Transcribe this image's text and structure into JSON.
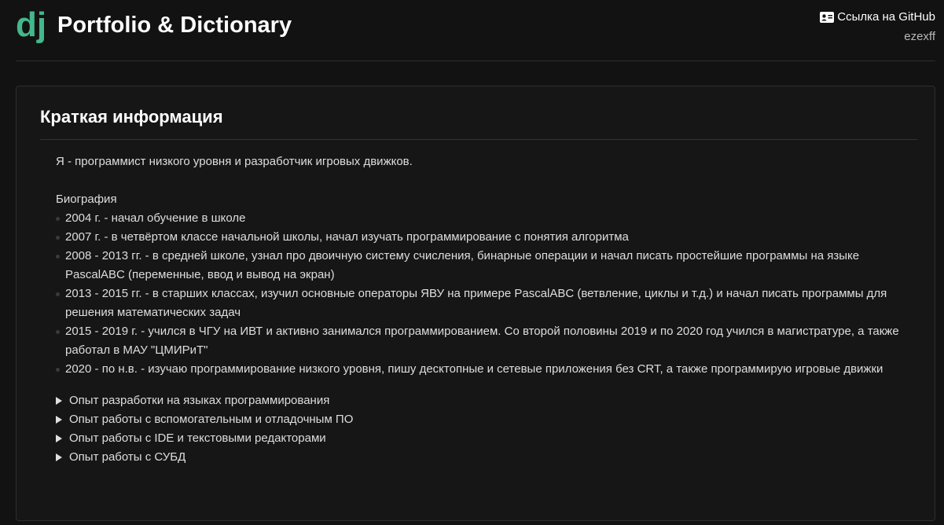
{
  "header": {
    "title": "Portfolio & Dictionary",
    "github_label": "Ссылка на GitHub",
    "username": "ezexff",
    "logo_text": "dj",
    "logo_color": "#44b78b"
  },
  "card": {
    "title": "Краткая информация",
    "intro": "Я - программист низкого уровня и разработчик игровых движков.",
    "bio_heading": "Биография",
    "bio_items": [
      "2004 г. - начал обучение в школе",
      "2007 г. - в четвёртом классе начальной школы, начал изучать программирование с понятия алгоритма",
      "2008 - 2013 гг. - в средней школе, узнал про двоичную систему счисления, бинарные операции и начал писать простейшие программы на языке PascalABC (переменные, ввод и вывод на экран)",
      "2013 - 2015 гг. - в старших классах, изучил основные операторы ЯВУ на примере PascalABC (ветвление, циклы и т.д.) и начал писать программы для решения математических задач",
      "2015 - 2019 г. - учился в ЧГУ на ИВТ и активно занимался программированием. Со второй половины 2019 и по 2020 год учился в магистратуре, а также работал в МАУ \"ЦМИРиТ\"",
      "2020 - по н.в. - изучаю программирование низкого уровня, пишу десктопные и сетевые приложения без CRT, а также программирую игровые движки"
    ],
    "sections": [
      "Опыт разработки на языках программирования",
      "Опыт работы с вспомогательным и отладочным ПО",
      "Опыт работы с IDE и текстовыми редакторами",
      "Опыт работы с СУБД"
    ]
  }
}
